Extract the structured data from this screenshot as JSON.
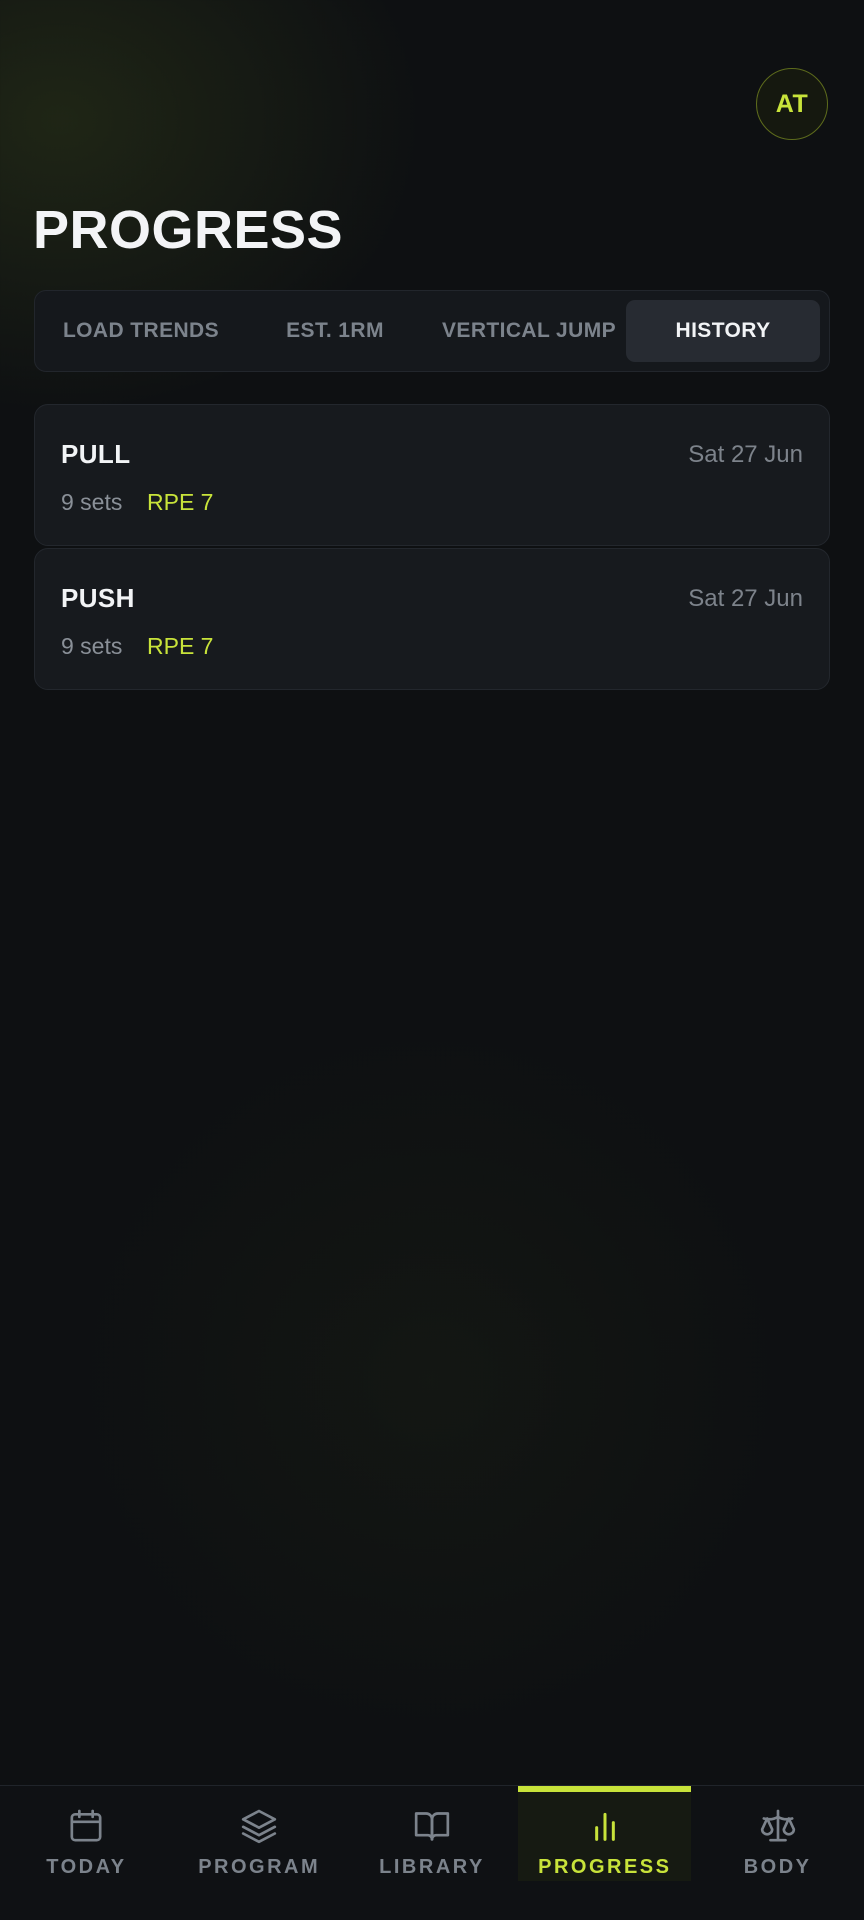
{
  "user": {
    "initials": "AT"
  },
  "page": {
    "title": "PROGRESS"
  },
  "tabs": [
    {
      "label": "LOAD TRENDS",
      "active": false
    },
    {
      "label": "EST. 1RM",
      "active": false
    },
    {
      "label": "VERTICAL JUMP",
      "active": false
    },
    {
      "label": "HISTORY",
      "active": true
    }
  ],
  "history": [
    {
      "title": "PULL",
      "date": "Sat 27 Jun",
      "sets": "9 sets",
      "rpe": "RPE 7"
    },
    {
      "title": "PUSH",
      "date": "Sat 27 Jun",
      "sets": "9 sets",
      "rpe": "RPE 7"
    }
  ],
  "nav": [
    {
      "label": "TODAY",
      "icon": "calendar-icon",
      "active": false
    },
    {
      "label": "PROGRAM",
      "icon": "layers-icon",
      "active": false
    },
    {
      "label": "LIBRARY",
      "icon": "book-open-icon",
      "active": false
    },
    {
      "label": "PROGRESS",
      "icon": "bar-chart-icon",
      "active": true
    },
    {
      "label": "BODY",
      "icon": "scale-icon",
      "active": false
    }
  ],
  "colors": {
    "accent": "#c8e33a",
    "background": "#0e1012",
    "card": "#171a1e",
    "muted_text": "#7c838c"
  }
}
